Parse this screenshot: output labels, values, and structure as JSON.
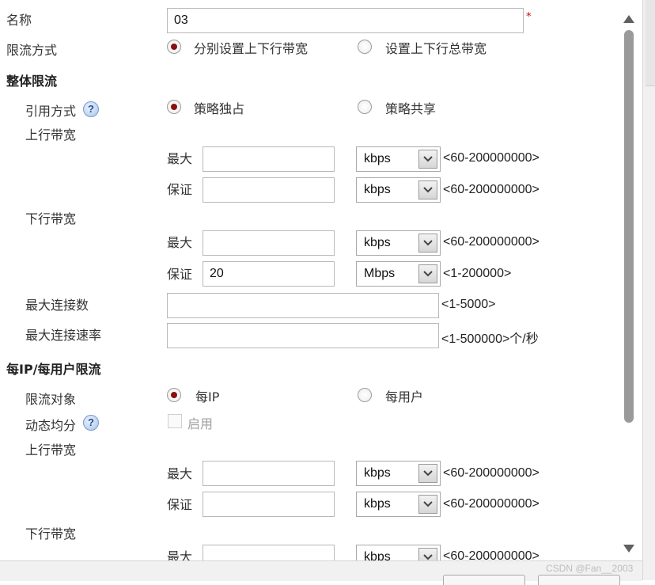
{
  "form": {
    "name_label": "名称",
    "name_value": "03",
    "required_mark": "*",
    "mode_label": "限流方式",
    "mode_options": [
      "分别设置上下行带宽",
      "设置上下行总带宽"
    ],
    "mode_selected": 0,
    "overall": {
      "title": "整体限流",
      "ref_label": "引用方式",
      "ref_options": [
        "策略独占",
        "策略共享"
      ],
      "ref_selected": 0,
      "up_label": "上行带宽",
      "down_label": "下行带宽",
      "max_label": "最大",
      "guar_label": "保证",
      "up_max": {
        "value": "",
        "unit": "kbps",
        "range": "<60-200000000>"
      },
      "up_guar": {
        "value": "",
        "unit": "kbps",
        "range": "<60-200000000>"
      },
      "down_max": {
        "value": "",
        "unit": "kbps",
        "range": "<60-200000000>"
      },
      "down_guar": {
        "value": "20",
        "unit": "Mbps",
        "range": "<1-200000>"
      },
      "max_conn_label": "最大连接数",
      "max_conn_value": "",
      "max_conn_range": "<1-5000>",
      "max_rate_label": "最大连接速率",
      "max_rate_value": "",
      "max_rate_range": "<1-500000>个/秒"
    },
    "per_ip": {
      "title": "每IP/每用户限流",
      "target_label": "限流对象",
      "target_options": [
        "每IP",
        "每用户"
      ],
      "target_selected": 0,
      "dynamic_label": "动态均分",
      "enable_label": "启用",
      "enable_checked": false,
      "up_label": "上行带宽",
      "down_label": "下行带宽",
      "max_label": "最大",
      "guar_label": "保证",
      "up_max": {
        "value": "",
        "unit": "kbps",
        "range": "<60-200000000>"
      },
      "up_guar": {
        "value": "",
        "unit": "kbps",
        "range": "<60-200000000>"
      },
      "down_max": {
        "value": "",
        "unit": "kbps",
        "range": "<60-200000000>"
      }
    }
  },
  "help_icon_glyph": "?",
  "watermark": "CSDN @Fan__2003",
  "colors": {
    "radio_selected": "#8b0f0f",
    "required": "#cc0000",
    "help_icon": "#1f4e96"
  },
  "icons": [
    "scroll-up-arrow-icon",
    "scroll-down-arrow-icon",
    "dropdown-arrow-icon",
    "help-icon"
  ]
}
